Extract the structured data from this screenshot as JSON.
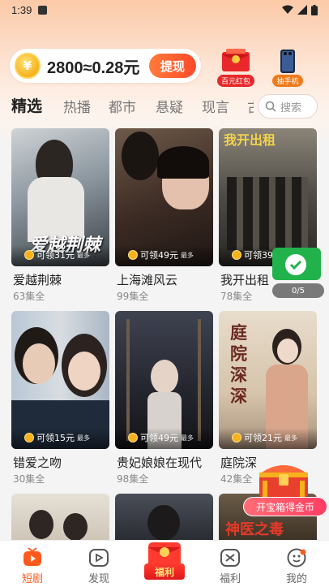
{
  "status": {
    "time": "1:39"
  },
  "coins": {
    "text": "2800≈0.28元",
    "coin_symbol": "¥",
    "withdraw_label": "提现"
  },
  "promos": [
    {
      "label": "百元红包",
      "color": "#e8282a"
    },
    {
      "label": "抽手机",
      "color": "#f07a1a"
    }
  ],
  "tabs": [
    "精选",
    "热播",
    "都市",
    "悬疑",
    "现言",
    "古"
  ],
  "active_tab": "精选",
  "search": {
    "placeholder": "搜索"
  },
  "dramas": [
    {
      "title": "爱越荆棘",
      "episodes": "63集全",
      "reward": "可领31元",
      "reward_max": "最多",
      "art_text": "爱越荆棘"
    },
    {
      "title": "上海滩风云",
      "episodes": "99集全",
      "reward": "可领49元",
      "reward_max": "最多",
      "art_text": ""
    },
    {
      "title": "我开出租",
      "episodes": "78集全",
      "reward": "可领39",
      "reward_max": "",
      "art_text": "我开出租"
    },
    {
      "title": "错爱之吻",
      "episodes": "30集全",
      "reward": "可领15元",
      "reward_max": "最多",
      "art_text": ""
    },
    {
      "title": "贵妃娘娘在现代",
      "episodes": "98集全",
      "reward": "可领49元",
      "reward_max": "最多",
      "art_text": ""
    },
    {
      "title": "庭院深",
      "episodes": "42集全",
      "reward": "可领21元",
      "reward_max": "最多",
      "art_text": "庭院深深"
    },
    {
      "title": "",
      "episodes": "",
      "reward": "",
      "reward_max": "",
      "art_text": ""
    },
    {
      "title": "",
      "episodes": "",
      "reward": "",
      "reward_max": "",
      "art_text": ""
    },
    {
      "title": "",
      "episodes": "",
      "reward": "",
      "reward_max": "",
      "art_text": "神医之毒"
    }
  ],
  "float_widget": {
    "progress": "0/5"
  },
  "treasure": {
    "label": "开宝箱得金币"
  },
  "nav": [
    {
      "label": "短剧",
      "icon": "tv-icon",
      "active": true
    },
    {
      "label": "发现",
      "icon": "play-icon",
      "active": false
    },
    {
      "label": "福利",
      "icon": "red-envelope-icon",
      "active": false
    },
    {
      "label": "福利",
      "icon": "gift-box-icon",
      "active": false
    },
    {
      "label": "我的",
      "icon": "profile-icon",
      "active": false
    }
  ],
  "colors": {
    "accent": "#ff5a1e",
    "withdraw": "#ff4a2a",
    "treasure": "#ff3d63"
  }
}
